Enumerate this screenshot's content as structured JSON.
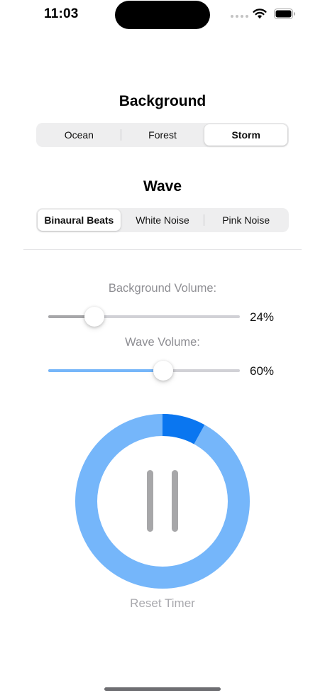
{
  "status_bar": {
    "time": "11:03"
  },
  "background": {
    "title": "Background",
    "options": [
      "Ocean",
      "Forest",
      "Storm"
    ],
    "selected": "Storm"
  },
  "wave": {
    "title": "Wave",
    "options": [
      "Binaural Beats",
      "White Noise",
      "Pink Noise"
    ],
    "selected": "Binaural Beats"
  },
  "background_volume": {
    "label": "Background Volume:",
    "value": 0.24,
    "value_text": "24%",
    "fill_color": "#a7a7a9"
  },
  "wave_volume": {
    "label": "Wave Volume:",
    "value": 0.6,
    "value_text": "60%",
    "fill_color": "#76b6f9"
  },
  "timer": {
    "progress": 0.08,
    "ring_color": "#75b6fa",
    "progress_color": "#0a76f0",
    "pause_icon": "pause-icon",
    "reset_label": "Reset Timer"
  },
  "icons": {
    "wifi": "wifi-icon",
    "battery": "battery-icon",
    "signal": "signal-dots-icon"
  }
}
